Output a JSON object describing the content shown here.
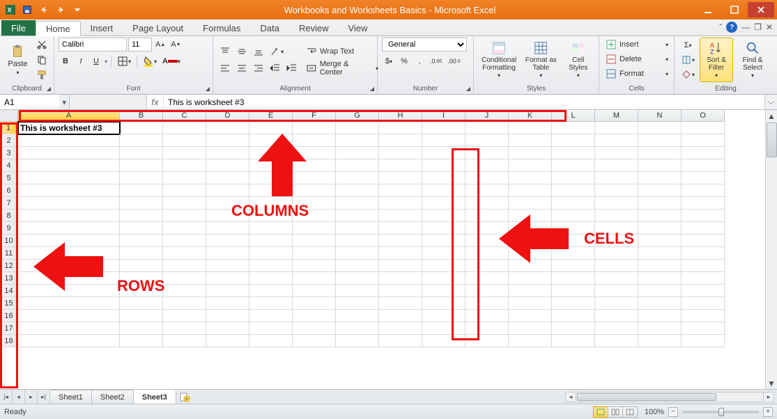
{
  "window": {
    "title": "Workbooks and Worksheets Basics - Microsoft Excel"
  },
  "qat": {
    "save": "Save",
    "undo": "Undo",
    "redo": "Redo"
  },
  "tabs": {
    "file": "File",
    "home": "Home",
    "insert": "Insert",
    "pagelayout": "Page Layout",
    "formulas": "Formulas",
    "data": "Data",
    "review": "Review",
    "view": "View"
  },
  "ribbon": {
    "clipboard": {
      "label": "Clipboard",
      "paste": "Paste"
    },
    "font": {
      "label": "Font",
      "name": "Calibri",
      "size": "11",
      "bold": "B",
      "italic": "I",
      "underline": "U"
    },
    "alignment": {
      "label": "Alignment",
      "wrap": "Wrap Text",
      "merge": "Merge & Center"
    },
    "number": {
      "label": "Number",
      "format": "General"
    },
    "styles": {
      "label": "Styles",
      "cond": "Conditional Formatting",
      "table": "Format as Table",
      "cell": "Cell Styles"
    },
    "cells": {
      "label": "Cells",
      "insert": "Insert",
      "delete": "Delete",
      "format": "Format"
    },
    "editing": {
      "label": "Editing",
      "sort": "Sort & Filter",
      "find": "Find & Select"
    }
  },
  "formulabar": {
    "namebox": "A1",
    "formula": "This is worksheet #3"
  },
  "grid": {
    "columns": [
      "A",
      "B",
      "C",
      "D",
      "E",
      "F",
      "G",
      "H",
      "I",
      "J",
      "K",
      "L",
      "M",
      "N",
      "O"
    ],
    "rows": [
      1,
      2,
      3,
      4,
      5,
      6,
      7,
      8,
      9,
      10,
      11,
      12,
      13,
      14,
      15,
      16,
      17,
      18
    ],
    "selected_col": "A",
    "selected_row": 1,
    "cell_A1": "This is worksheet #3"
  },
  "annotations": {
    "columns": "COLUMNS",
    "rows": "ROWS",
    "cells": "CELLS"
  },
  "sheets": {
    "tabs": [
      "Sheet1",
      "Sheet2",
      "Sheet3"
    ],
    "active": "Sheet3"
  },
  "status": {
    "ready": "Ready",
    "zoom": "100%"
  }
}
